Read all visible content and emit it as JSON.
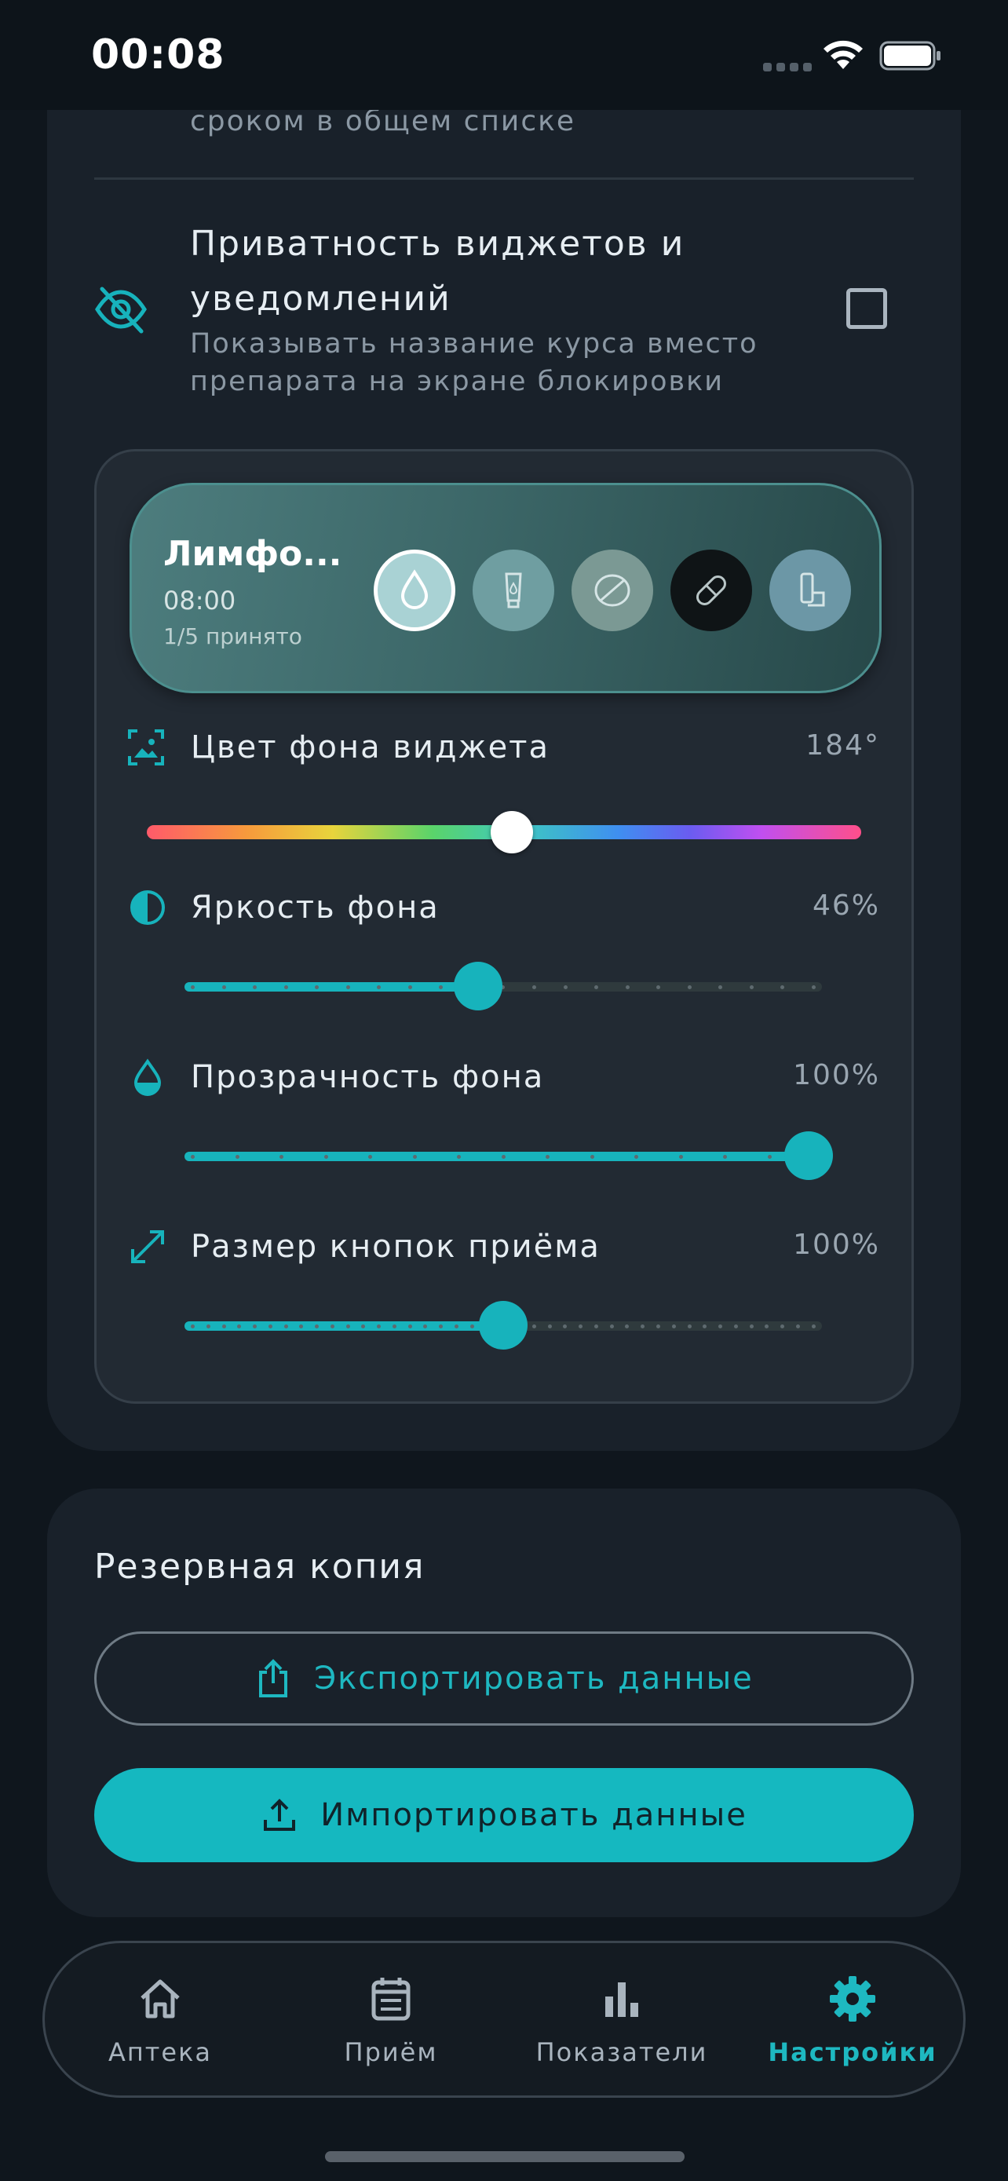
{
  "status_bar": {
    "time": "00:08"
  },
  "top_card": {
    "prev_item_tail": "сроком в общем списке",
    "privacy": {
      "title": "Приватность виджетов и уведомлений",
      "description": "Показывать название курса вместо препарата на экране блокировки",
      "checked": false,
      "icon": "eye-off-icon"
    },
    "widget_preview": {
      "name": "Лимфо...",
      "time": "08:00",
      "status": "1/5 принято",
      "dose_icons": [
        "drop-icon",
        "tube-icon",
        "tablet-icon",
        "capsule-icon",
        "inhaler-icon"
      ]
    },
    "settings": {
      "bg_color": {
        "label": "Цвет фона виджета",
        "value": "184°",
        "hue": 184,
        "icon": "image-frame-icon"
      },
      "brightness": {
        "label": "Яркость фона",
        "value": "46%",
        "fraction": 0.46,
        "icon": "contrast-icon"
      },
      "opacity": {
        "label": "Прозрачность фона",
        "value": "100%",
        "fraction": 1.0,
        "icon": "drop-half-icon"
      },
      "button_size": {
        "label": "Размер кнопок приёма",
        "value": "100%",
        "fraction": 0.5,
        "icon": "resize-icon"
      }
    }
  },
  "backup": {
    "title": "Резервная копия",
    "export_label": "Экспортировать данные",
    "import_label": "Импортировать данные"
  },
  "nav": {
    "items": [
      {
        "label": "Аптека",
        "icon": "home-icon",
        "active": false
      },
      {
        "label": "Приём",
        "icon": "calendar-list-icon",
        "active": false
      },
      {
        "label": "Показатели",
        "icon": "bar-chart-icon",
        "active": false
      },
      {
        "label": "Настройки",
        "icon": "gear-icon",
        "active": true
      }
    ]
  },
  "colors": {
    "accent": "#17b3bc",
    "background": "#0f161d",
    "card": "#19212a"
  }
}
